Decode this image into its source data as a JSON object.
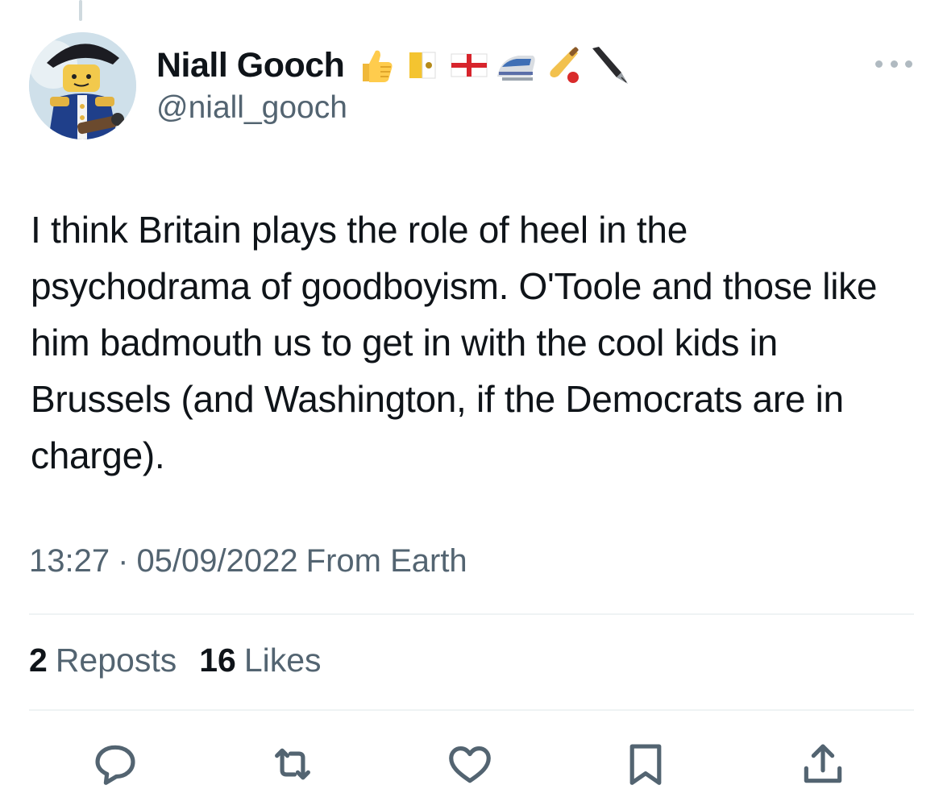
{
  "user": {
    "display_name": "Niall Gooch",
    "handle": "@niall_gooch",
    "badges": [
      "thumbs-up-emoji",
      "vatican-flag-emoji",
      "england-flag-emoji",
      "train-emoji",
      "cricket-emoji",
      "fountain-pen-emoji"
    ]
  },
  "tweet": {
    "text": "I think Britain plays the role of heel in the psychodrama of goodboyism. O'Toole and those like him badmouth us to get in with the cool kids in Brussels (and Washington, if the Democrats are in charge).",
    "time": "13:27",
    "separator": "·",
    "date": "05/09/2022",
    "source": "From Earth"
  },
  "stats": {
    "reposts_count": "2",
    "reposts_label": "Reposts",
    "likes_count": "16",
    "likes_label": "Likes"
  },
  "actions": [
    "reply-icon",
    "repost-icon",
    "like-icon",
    "bookmark-icon",
    "share-icon"
  ],
  "colors": {
    "text": "#0f1419",
    "secondary": "#536471",
    "divider": "#eff3f4",
    "icon": "#536471"
  }
}
